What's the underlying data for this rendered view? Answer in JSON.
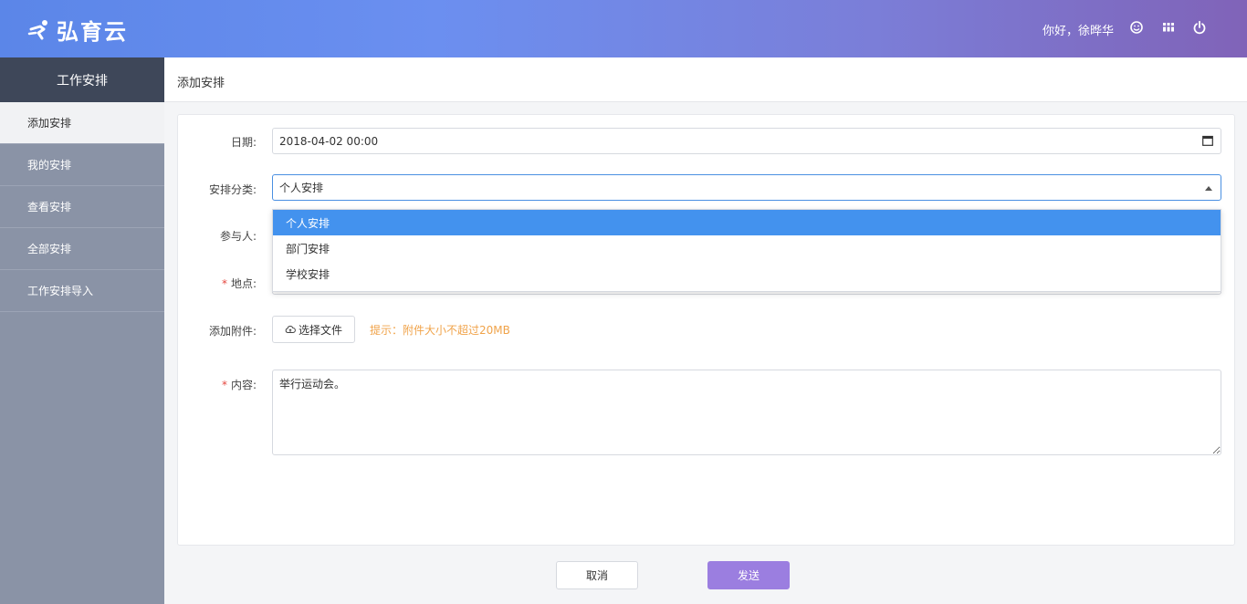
{
  "header": {
    "logo_text": "弘育云",
    "greeting": "你好，徐晔华"
  },
  "sidebar": {
    "title": "工作安排",
    "items": [
      {
        "label": "添加安排",
        "active": true
      },
      {
        "label": "我的安排",
        "active": false
      },
      {
        "label": "查看安排",
        "active": false
      },
      {
        "label": "全部安排",
        "active": false
      },
      {
        "label": "工作安排导入",
        "active": false
      }
    ]
  },
  "topbar": {
    "title": "添加安排"
  },
  "form": {
    "date": {
      "label": "日期:",
      "value": "2018-04-02 00:00"
    },
    "category": {
      "label": "安排分类:",
      "value": "个人安排",
      "options": [
        "个人安排",
        "部门安排",
        "学校安排"
      ],
      "selected_index": 0
    },
    "participants": {
      "label": "参与人:"
    },
    "location": {
      "required_mark": "*",
      "label": "地点:"
    },
    "attachment": {
      "label": "添加附件:",
      "button_label": "选择文件",
      "hint": "提示：附件大小不超过20MB"
    },
    "content": {
      "required_mark": "*",
      "label": "内容:",
      "value": "举行运动会。"
    }
  },
  "actions": {
    "cancel_label": "取消",
    "send_label": "发送"
  },
  "colors": {
    "accent_blue": "#4392ee",
    "send_purple": "#9b7ee0",
    "sidebar_bg": "#8a93a6",
    "sidebar_title_bg": "#3e4759",
    "hint_orange": "#f0a34a",
    "required_red": "#e5473f"
  }
}
